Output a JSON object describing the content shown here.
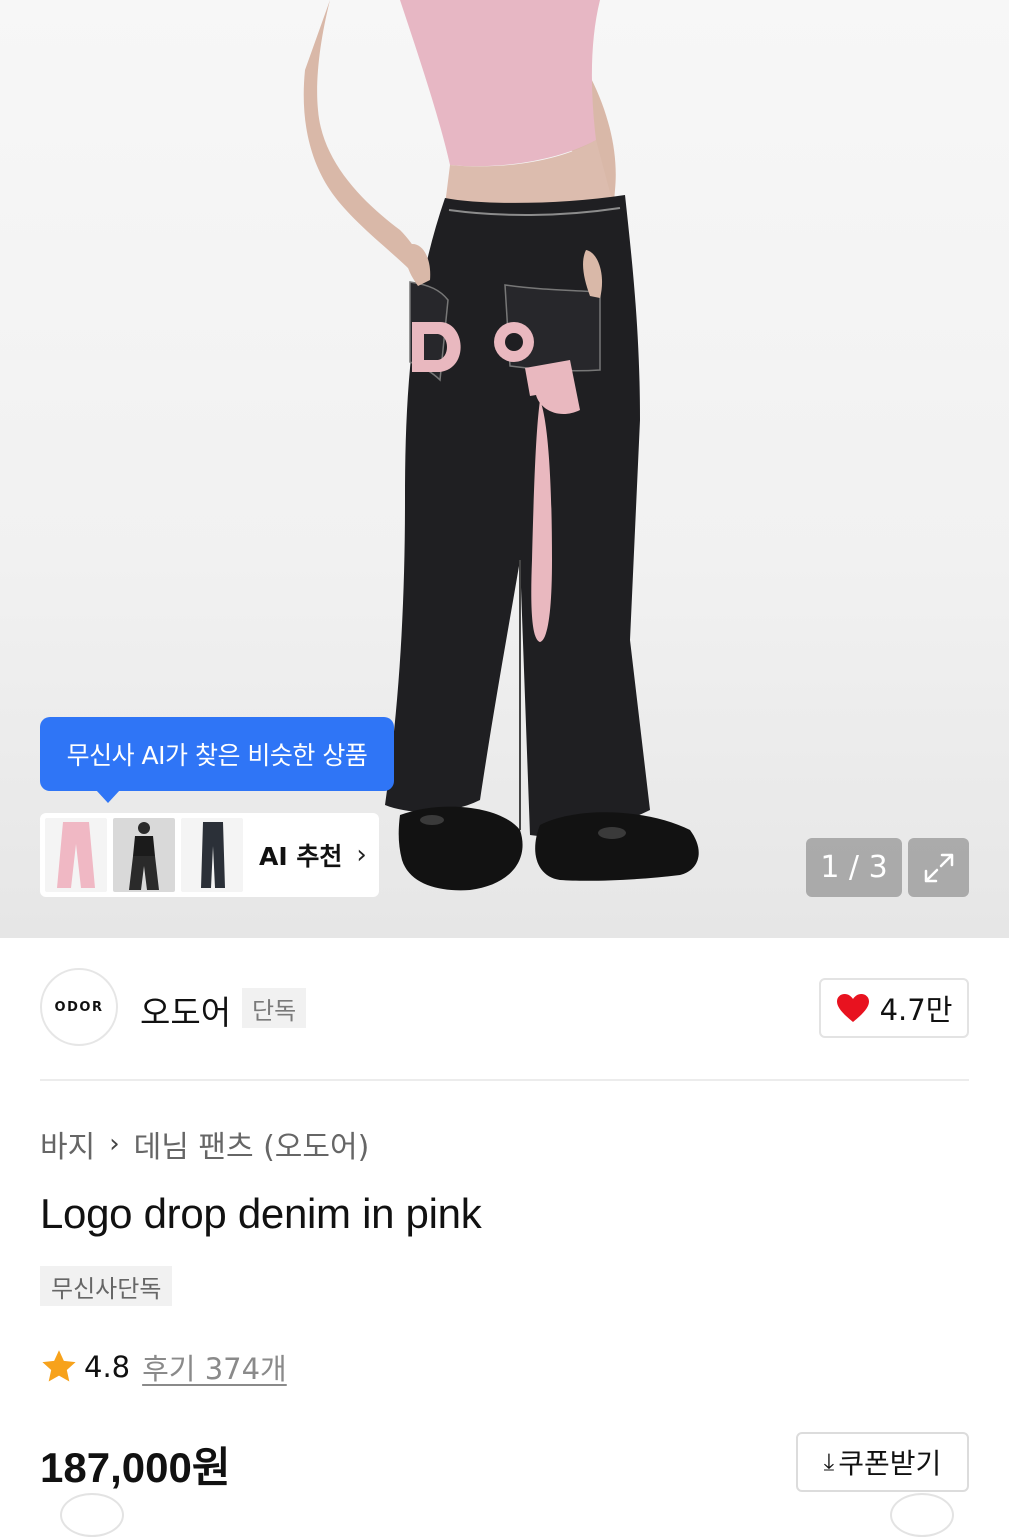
{
  "gallery": {
    "ai_tooltip": "무신사 AI가 찾은 비슷한 상품",
    "ai_recommend_label": "AI 추천",
    "counter": "1 / 3",
    "photo_logo_text": "ODOR"
  },
  "brand": {
    "logo_text": "ODOR",
    "name": "오도어",
    "badge": "단독",
    "likes": "4.7만"
  },
  "product": {
    "breadcrumb": [
      "바지",
      "데님 팬츠 (오도어)"
    ],
    "title": "Logo drop denim in pink",
    "tag": "무신사단독",
    "rating": "4.8",
    "reviews": "후기 374개",
    "price": "187,000원",
    "coupon_label": "쿠폰받기"
  },
  "colors": {
    "accent": "#2f75f6",
    "heart": "#e8121f",
    "star": "#f7a21b",
    "denim": "#1f1f22",
    "pink": "#e9b8bf"
  }
}
